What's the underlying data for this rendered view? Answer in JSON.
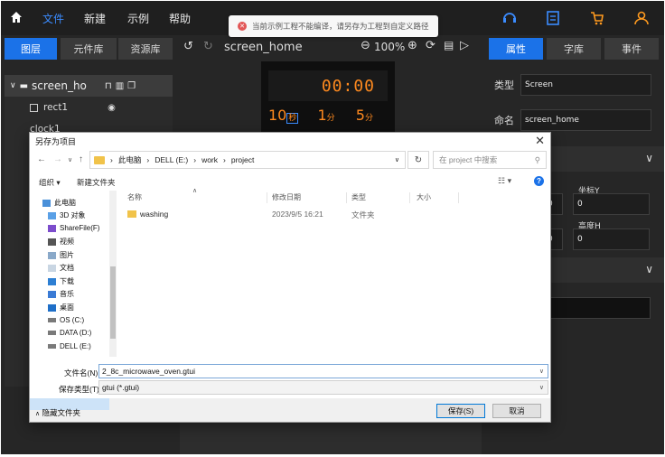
{
  "topbar": {
    "menus": [
      "文件",
      "新建",
      "示例",
      "帮助"
    ],
    "active_menu": "文件",
    "right_icons": [
      "headset-icon",
      "document-icon",
      "cart-icon",
      "user-icon"
    ]
  },
  "toast": {
    "text": "当前示例工程不能编译，请另存为工程到自定义路径"
  },
  "left_panel": {
    "tabs": [
      "图层",
      "元件库",
      "资源库"
    ],
    "active_tab": "图层",
    "tree": {
      "root": "screen_ho",
      "items": [
        "rect1",
        "clock1"
      ]
    }
  },
  "canvas": {
    "screen_name": "screen_home",
    "zoom": "100%",
    "clock_text": "00:00",
    "row": [
      {
        "num": "10",
        "unit": "秒"
      },
      {
        "num": "1",
        "unit": "分"
      },
      {
        "num": "5",
        "unit": "分"
      }
    ]
  },
  "right_panel": {
    "tabs": [
      "属性",
      "字库",
      "事件"
    ],
    "active_tab": "属性",
    "type_label": "类型",
    "type_value": "Screen",
    "name_label": "命名",
    "name_value": "screen_home",
    "coord_y_label": "坐标Y",
    "coord_y_value": "0",
    "height_label": "高度H",
    "height_value": "0",
    "left_value_1": "0",
    "left_value_2": "0"
  },
  "dialog": {
    "title": "另存为项目",
    "address": [
      "此电脑",
      "DELL (E:)",
      "work",
      "project"
    ],
    "search_placeholder": "在 project 中搜索",
    "organize": "组织 ▾",
    "new_folder": "新建文件夹",
    "nav_items": [
      {
        "label": "此电脑",
        "icon": "pc-icon"
      },
      {
        "label": "3D 对象",
        "icon": "cube-icon"
      },
      {
        "label": "ShareFile(F)",
        "icon": "share-icon"
      },
      {
        "label": "视频",
        "icon": "video-icon"
      },
      {
        "label": "图片",
        "icon": "picture-icon"
      },
      {
        "label": "文档",
        "icon": "docs-icon"
      },
      {
        "label": "下载",
        "icon": "download-icon"
      },
      {
        "label": "音乐",
        "icon": "music-icon"
      },
      {
        "label": "桌面",
        "icon": "desktop-icon"
      },
      {
        "label": "OS (C:)",
        "icon": "drive-icon"
      },
      {
        "label": "DATA (D:)",
        "icon": "drive-icon"
      },
      {
        "label": "DELL (E:)",
        "icon": "drive-icon"
      }
    ],
    "columns": [
      "名称",
      "修改日期",
      "类型",
      "大小"
    ],
    "files": [
      {
        "name": "washing",
        "date": "2023/9/5 16:21",
        "type": "文件夹",
        "size": ""
      }
    ],
    "filename_label": "文件名(N):",
    "filename_value": "2_8c_microwave_oven.gtui",
    "filetype_label": "保存类型(T):",
    "filetype_value": "gtui (*.gtui)",
    "hide_folders": "隐藏文件夹",
    "save_button": "保存(S)",
    "cancel_button": "取消"
  }
}
